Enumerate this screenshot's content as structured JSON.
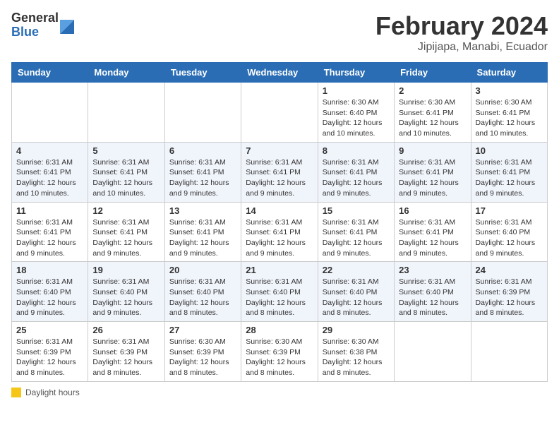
{
  "header": {
    "logo_general": "General",
    "logo_blue": "Blue",
    "title": "February 2024",
    "subtitle": "Jipijapa, Manabi, Ecuador"
  },
  "weekdays": [
    "Sunday",
    "Monday",
    "Tuesday",
    "Wednesday",
    "Thursday",
    "Friday",
    "Saturday"
  ],
  "footer": {
    "daylight_label": "Daylight hours"
  },
  "weeks": [
    [
      {
        "day": "",
        "info": ""
      },
      {
        "day": "",
        "info": ""
      },
      {
        "day": "",
        "info": ""
      },
      {
        "day": "",
        "info": ""
      },
      {
        "day": "1",
        "info": "Sunrise: 6:30 AM\nSunset: 6:40 PM\nDaylight: 12 hours\nand 10 minutes."
      },
      {
        "day": "2",
        "info": "Sunrise: 6:30 AM\nSunset: 6:41 PM\nDaylight: 12 hours\nand 10 minutes."
      },
      {
        "day": "3",
        "info": "Sunrise: 6:30 AM\nSunset: 6:41 PM\nDaylight: 12 hours\nand 10 minutes."
      }
    ],
    [
      {
        "day": "4",
        "info": "Sunrise: 6:31 AM\nSunset: 6:41 PM\nDaylight: 12 hours\nand 10 minutes."
      },
      {
        "day": "5",
        "info": "Sunrise: 6:31 AM\nSunset: 6:41 PM\nDaylight: 12 hours\nand 10 minutes."
      },
      {
        "day": "6",
        "info": "Sunrise: 6:31 AM\nSunset: 6:41 PM\nDaylight: 12 hours\nand 9 minutes."
      },
      {
        "day": "7",
        "info": "Sunrise: 6:31 AM\nSunset: 6:41 PM\nDaylight: 12 hours\nand 9 minutes."
      },
      {
        "day": "8",
        "info": "Sunrise: 6:31 AM\nSunset: 6:41 PM\nDaylight: 12 hours\nand 9 minutes."
      },
      {
        "day": "9",
        "info": "Sunrise: 6:31 AM\nSunset: 6:41 PM\nDaylight: 12 hours\nand 9 minutes."
      },
      {
        "day": "10",
        "info": "Sunrise: 6:31 AM\nSunset: 6:41 PM\nDaylight: 12 hours\nand 9 minutes."
      }
    ],
    [
      {
        "day": "11",
        "info": "Sunrise: 6:31 AM\nSunset: 6:41 PM\nDaylight: 12 hours\nand 9 minutes."
      },
      {
        "day": "12",
        "info": "Sunrise: 6:31 AM\nSunset: 6:41 PM\nDaylight: 12 hours\nand 9 minutes."
      },
      {
        "day": "13",
        "info": "Sunrise: 6:31 AM\nSunset: 6:41 PM\nDaylight: 12 hours\nand 9 minutes."
      },
      {
        "day": "14",
        "info": "Sunrise: 6:31 AM\nSunset: 6:41 PM\nDaylight: 12 hours\nand 9 minutes."
      },
      {
        "day": "15",
        "info": "Sunrise: 6:31 AM\nSunset: 6:41 PM\nDaylight: 12 hours\nand 9 minutes."
      },
      {
        "day": "16",
        "info": "Sunrise: 6:31 AM\nSunset: 6:41 PM\nDaylight: 12 hours\nand 9 minutes."
      },
      {
        "day": "17",
        "info": "Sunrise: 6:31 AM\nSunset: 6:40 PM\nDaylight: 12 hours\nand 9 minutes."
      }
    ],
    [
      {
        "day": "18",
        "info": "Sunrise: 6:31 AM\nSunset: 6:40 PM\nDaylight: 12 hours\nand 9 minutes."
      },
      {
        "day": "19",
        "info": "Sunrise: 6:31 AM\nSunset: 6:40 PM\nDaylight: 12 hours\nand 9 minutes."
      },
      {
        "day": "20",
        "info": "Sunrise: 6:31 AM\nSunset: 6:40 PM\nDaylight: 12 hours\nand 8 minutes."
      },
      {
        "day": "21",
        "info": "Sunrise: 6:31 AM\nSunset: 6:40 PM\nDaylight: 12 hours\nand 8 minutes."
      },
      {
        "day": "22",
        "info": "Sunrise: 6:31 AM\nSunset: 6:40 PM\nDaylight: 12 hours\nand 8 minutes."
      },
      {
        "day": "23",
        "info": "Sunrise: 6:31 AM\nSunset: 6:40 PM\nDaylight: 12 hours\nand 8 minutes."
      },
      {
        "day": "24",
        "info": "Sunrise: 6:31 AM\nSunset: 6:39 PM\nDaylight: 12 hours\nand 8 minutes."
      }
    ],
    [
      {
        "day": "25",
        "info": "Sunrise: 6:31 AM\nSunset: 6:39 PM\nDaylight: 12 hours\nand 8 minutes."
      },
      {
        "day": "26",
        "info": "Sunrise: 6:31 AM\nSunset: 6:39 PM\nDaylight: 12 hours\nand 8 minutes."
      },
      {
        "day": "27",
        "info": "Sunrise: 6:30 AM\nSunset: 6:39 PM\nDaylight: 12 hours\nand 8 minutes."
      },
      {
        "day": "28",
        "info": "Sunrise: 6:30 AM\nSunset: 6:39 PM\nDaylight: 12 hours\nand 8 minutes."
      },
      {
        "day": "29",
        "info": "Sunrise: 6:30 AM\nSunset: 6:38 PM\nDaylight: 12 hours\nand 8 minutes."
      },
      {
        "day": "",
        "info": ""
      },
      {
        "day": "",
        "info": ""
      }
    ]
  ]
}
